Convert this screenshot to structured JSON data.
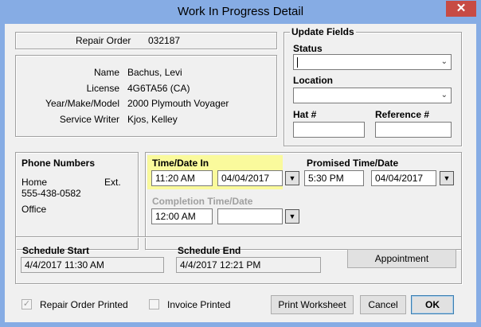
{
  "window": {
    "title": "Work In Progress Detail",
    "close_glyph": "✕"
  },
  "repair": {
    "label": "Repair Order",
    "value": "032187"
  },
  "customer": {
    "name_label": "Name",
    "name": "Bachus, Levi",
    "license_label": "License",
    "license": "4G6TA56 (CA)",
    "ymm_label": "Year/Make/Model",
    "ymm": "2000 Plymouth Voyager",
    "writer_label": "Service Writer",
    "writer": "Kjos, Kelley"
  },
  "update": {
    "title": "Update Fields",
    "status_label": "Status",
    "status_value": "",
    "location_label": "Location",
    "location_value": "",
    "hat_label": "Hat #",
    "hat_value": "",
    "reference_label": "Reference #",
    "reference_value": ""
  },
  "phone": {
    "title": "Phone Numbers",
    "home_label": "Home",
    "ext_label": "Ext.",
    "home_value": "555-438-0582",
    "office_label": "Office"
  },
  "timedate": {
    "in_label": "Time/Date In",
    "in_time": "11:20 AM",
    "in_date": "04/04/2017",
    "promised_label": "Promised Time/Date",
    "promised_time": "5:30 PM",
    "promised_date": "04/04/2017",
    "completion_label": "Completion Time/Date",
    "completion_time": "12:00 AM",
    "completion_date": "",
    "drop_glyph": "▼"
  },
  "schedule": {
    "start_label": "Schedule Start",
    "start_value": "4/4/2017 11:30 AM",
    "end_label": "Schedule End",
    "end_value": "4/4/2017 12:21 PM",
    "appointment_label": "Appointment"
  },
  "footer": {
    "ro_printed_label": "Repair Order Printed",
    "ro_printed_checked": "✓",
    "invoice_printed_label": "Invoice Printed",
    "invoice_printed_checked": "",
    "print_label": "Print Worksheet",
    "cancel_label": "Cancel",
    "ok_label": "OK"
  },
  "colors": {
    "title_bar": "#86ace4",
    "close": "#c74b44",
    "highlight": "#fafa9c"
  }
}
